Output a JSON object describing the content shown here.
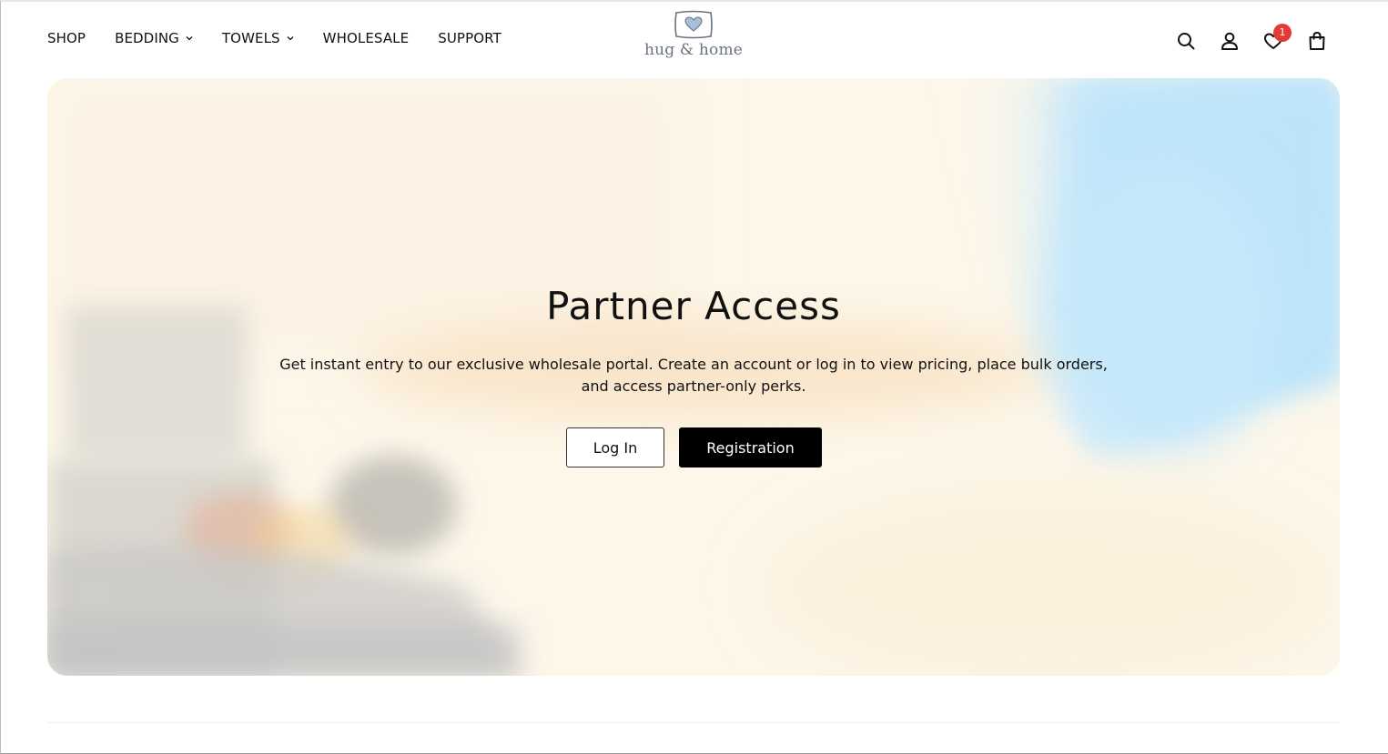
{
  "nav": {
    "items": [
      {
        "label": "SHOP",
        "dropdown": false
      },
      {
        "label": "BEDDING",
        "dropdown": true
      },
      {
        "label": "TOWELS",
        "dropdown": true
      },
      {
        "label": "WHOLESALE",
        "dropdown": false
      },
      {
        "label": "SUPPORT",
        "dropdown": false
      }
    ]
  },
  "logo": {
    "text": "hug & home",
    "icon": "pillow-heart-icon"
  },
  "header_icons": {
    "search": "search-icon",
    "account": "user-icon",
    "wishlist": "heart-icon",
    "wishlist_count": "1",
    "cart": "shopping-bag-icon"
  },
  "hero": {
    "title": "Partner Access",
    "description": "Get instant entry to our exclusive wholesale portal. Create an account or log in to view pricing, place bulk orders, and access partner-only perks.",
    "login_label": "Log In",
    "register_label": "Registration"
  },
  "colors": {
    "badge": "#e53935",
    "primary_button": "#000000",
    "hero_bg": "#fdf7ea",
    "hero_accent_blue": "#bfe6fb",
    "logo_text": "#6a7280"
  }
}
